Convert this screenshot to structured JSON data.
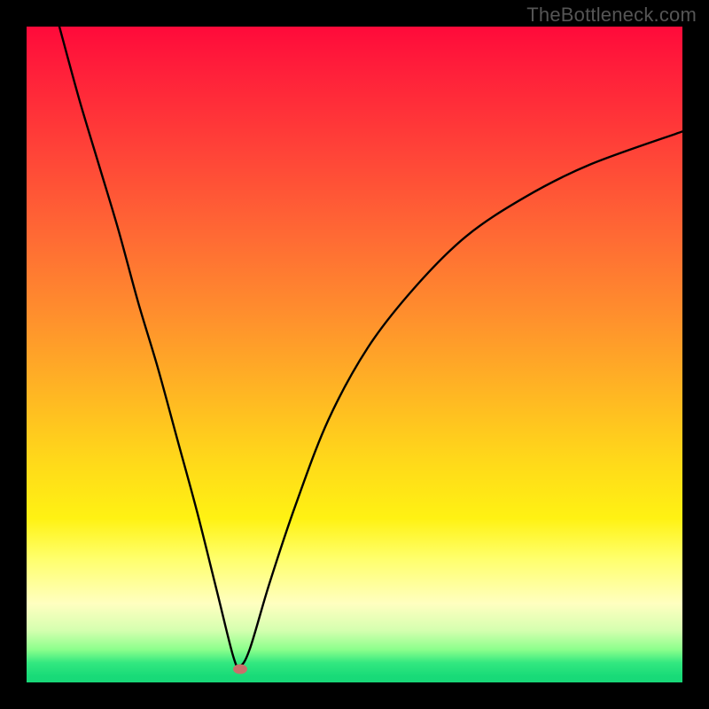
{
  "watermark": "TheBottleneck.com",
  "colors": {
    "frame_background": "#000000",
    "gradient_top": "#ff0a3a",
    "gradient_mid1": "#ff8f2d",
    "gradient_mid2": "#ffff6a",
    "gradient_bottom": "#18d878",
    "curve_stroke": "#000000",
    "marker_fill": "#c96f6b",
    "watermark_text": "#555555"
  },
  "chart_data": {
    "type": "line",
    "title": "",
    "xlabel": "",
    "ylabel": "",
    "xlim": [
      0,
      100
    ],
    "ylim": [
      0,
      100
    ],
    "grid": false,
    "note": "Values are estimated from pixels (0=bottom/left, 100=top/right). Curve drops steeply from top-left to a minimum near x≈32, then rises with diminishing slope toward upper right. A small marker sits at the minimum.",
    "series": [
      {
        "name": "curve",
        "x": [
          5,
          8,
          11,
          14,
          17,
          20,
          23,
          26,
          29,
          31.5,
          32.5,
          34,
          37,
          41,
          46,
          52,
          59,
          67,
          76,
          86,
          100
        ],
        "y": [
          100,
          89,
          79,
          69,
          58,
          48,
          37,
          26,
          14,
          4,
          2.5,
          5,
          15,
          27,
          40,
          51,
          60,
          68,
          74,
          79,
          84
        ]
      }
    ],
    "marker": {
      "x": 32.5,
      "y": 2,
      "shape": "ellipse"
    }
  }
}
